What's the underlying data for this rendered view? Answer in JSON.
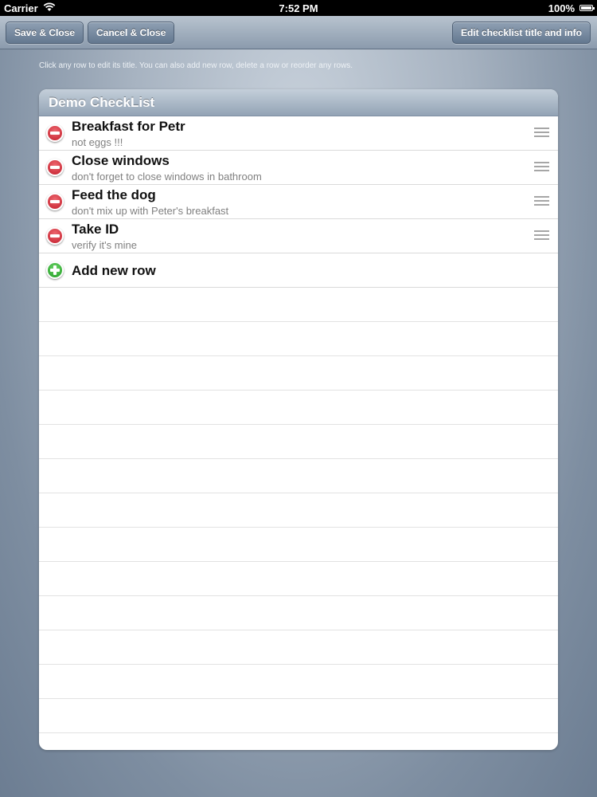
{
  "status_bar": {
    "carrier": "Carrier",
    "time": "7:52 PM",
    "battery": "100%"
  },
  "toolbar": {
    "save_label": "Save & Close",
    "cancel_label": "Cancel & Close",
    "edit_label": "Edit checklist title and info"
  },
  "hint": "Click any row to edit its title. You can also add new row, delete a row or reorder any rows.",
  "checklist": {
    "title": "Demo CheckList",
    "items": [
      {
        "title": "Breakfast for Petr",
        "subtitle": "not eggs !!!"
      },
      {
        "title": "Close windows",
        "subtitle": "don't forget to close windows in bathroom"
      },
      {
        "title": "Feed the dog",
        "subtitle": "don't mix up with Peter's breakfast"
      },
      {
        "title": "Take ID",
        "subtitle": "verify it's mine"
      }
    ],
    "add_row_label": "Add new row"
  }
}
